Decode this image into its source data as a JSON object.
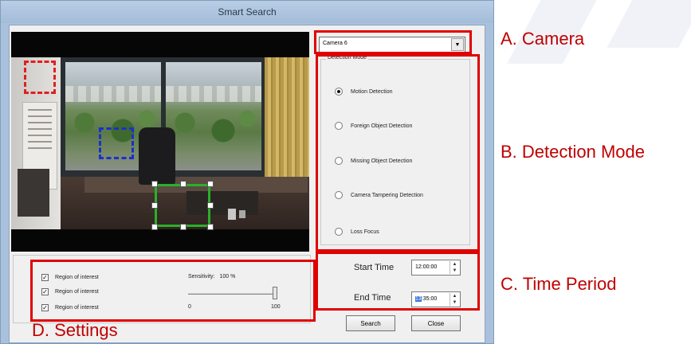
{
  "window": {
    "title": "Smart Search"
  },
  "camera": {
    "selected": "Camera 6"
  },
  "detection_mode": {
    "group_title": "Detection Mode",
    "options": [
      {
        "label": "Motion Detection",
        "checked": true
      },
      {
        "label": "Foreign Object Detection",
        "checked": false
      },
      {
        "label": "Missing Object Detection",
        "checked": false
      },
      {
        "label": "Camera Tampering Detection",
        "checked": false
      },
      {
        "label": "Loss Focus",
        "checked": false
      }
    ]
  },
  "settings": {
    "regions": [
      {
        "label": "Region of interest",
        "checked": true
      },
      {
        "label": "Region of interest",
        "checked": true
      },
      {
        "label": "Region of interest",
        "checked": true
      }
    ],
    "sensitivity_label": "Sensitivity:",
    "sensitivity_value": "100 %",
    "slider_min": "0",
    "slider_max": "100",
    "sensitivity_fraction": 1.0
  },
  "time_period": {
    "start_label": "Start Time",
    "start_value": "12:00:00",
    "end_label": "End Time",
    "end_value_hour": "13",
    "end_value_rest": ":35:00"
  },
  "buttons": {
    "search": "Search",
    "close": "Close"
  },
  "annotations": {
    "a": "A. Camera",
    "b": "B. Detection Mode",
    "c": "C. Time Period",
    "d": "D. Settings"
  },
  "colors": {
    "annotation_red": "#e00000",
    "roi_red": "#e02020",
    "roi_blue": "#1a2fd0",
    "roi_green": "#2ab02a"
  }
}
